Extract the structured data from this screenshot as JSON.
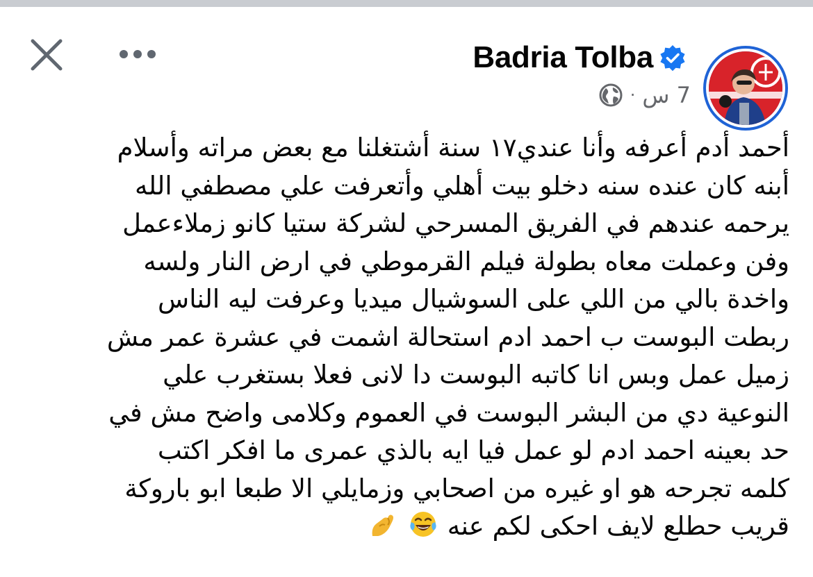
{
  "post": {
    "author_name": "Badria Tolba",
    "verified": true,
    "time_ago": "7 س",
    "audience_icon": "globe-icon",
    "lines": [
      "أحمد أدم أعرفه وأنا عندي١٧ سنة أشتغلنا مع بعض مراته وأسلام",
      "أبنه كان عنده سنه دخلو بيت أهلي وأتعرفت علي مصطفي الله",
      "يرحمه عندهم في الفريق المسرحي لشركة ستيا كانو زملاءعمل",
      "وفن وعملت معاه بطولة فيلم القرموطي في ارض النار ولسه",
      "واخدة بالي من اللي على السوشيال ميديا وعرفت ليه الناس",
      "ربطت البوست ب احمد ادم استحالة اشمت في عشرة عمر مش",
      "زميل عمل وبس انا كاتبه البوست دا لانى فعلا بستغرب علي",
      "النوعية دي من البشر البوست في العموم وكلامى واضح مش في",
      "حد بعينه احمد ادم لو عمل فيا ايه بالذي عمرى ما افكر اكتب",
      "كلمه تجرحه هو او غيره من اصحابي وزمايلي الا طبعا ابو باروكة",
      "قريب حطلع لايف احكى لكم عنه"
    ],
    "last_line_emojis": [
      "laughing-tears-emoji",
      "pinching-hand-emoji"
    ]
  },
  "colors": {
    "verified_badge": "#1877f2",
    "meta_text": "#65676b",
    "text": "#050505",
    "avatar_ring": "#1f63d6"
  }
}
